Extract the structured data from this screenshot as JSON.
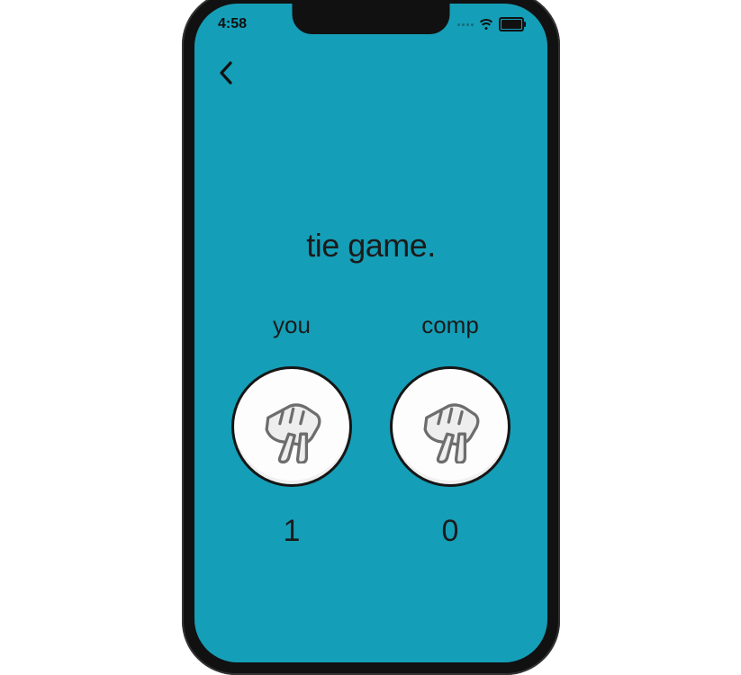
{
  "status_bar": {
    "time": "4:58"
  },
  "game": {
    "result_text": "tie game.",
    "players": [
      {
        "label": "you",
        "gesture": "scissors",
        "score": "1"
      },
      {
        "label": "comp",
        "gesture": "scissors",
        "score": "0"
      }
    ]
  },
  "colors": {
    "background_teal": "#159eb7",
    "text": "#1b1b1b",
    "hand_circle_bg": "#fdfdfd",
    "hand_circle_border": "#161616"
  }
}
